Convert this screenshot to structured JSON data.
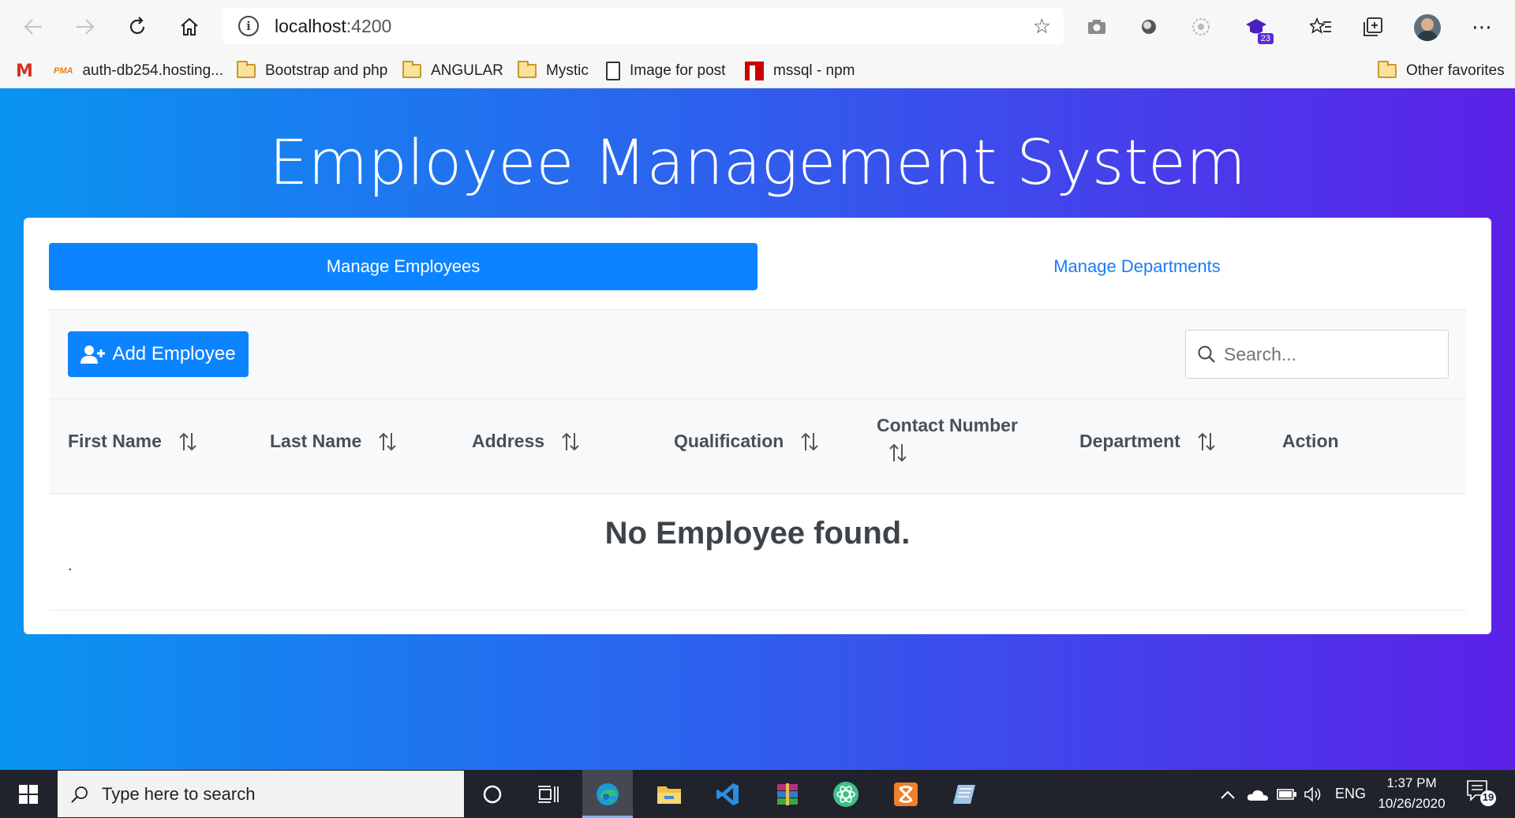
{
  "browser": {
    "address": {
      "host": "localhost",
      "port": ":4200"
    },
    "ext_badge": "23",
    "bookmarks": [
      {
        "label": "",
        "icon": "gmail-icon"
      },
      {
        "label": "auth-db254.hosting...",
        "icon": "phpmyadmin-icon"
      },
      {
        "label": "Bootstrap and php",
        "icon": "folder-icon"
      },
      {
        "label": "ANGULAR",
        "icon": "folder-icon"
      },
      {
        "label": "Mystic",
        "icon": "folder-icon"
      },
      {
        "label": "Image for post",
        "icon": "page-icon"
      },
      {
        "label": "mssql - npm",
        "icon": "npm-icon"
      },
      {
        "label": "Other favorites",
        "icon": "folder-icon"
      }
    ],
    "pma_label": "PMA"
  },
  "app": {
    "title": "Employee Management System",
    "tabs": [
      {
        "label": "Manage Employees",
        "active": true
      },
      {
        "label": "Manage Departments",
        "active": false
      }
    ],
    "add_button": "Add Employee",
    "search_placeholder": "Search...",
    "columns": [
      {
        "label": "First Name",
        "sortable": true
      },
      {
        "label": "Last Name",
        "sortable": true
      },
      {
        "label": "Address",
        "sortable": true
      },
      {
        "label": "Qualification",
        "sortable": true
      },
      {
        "label": "Contact Number",
        "sortable": true
      },
      {
        "label": "Department",
        "sortable": true
      },
      {
        "label": "Action",
        "sortable": false
      }
    ],
    "empty_message": "No Employee found.",
    "footer_dot": "."
  },
  "taskbar": {
    "search_placeholder": "Type here to search",
    "language": "ENG",
    "time": "1:37 PM",
    "date": "10/26/2020",
    "notifications": "19"
  },
  "colors": {
    "primary": "#0d84ff",
    "gradient_start": "#0994f1",
    "gradient_end": "#5c21e8"
  }
}
